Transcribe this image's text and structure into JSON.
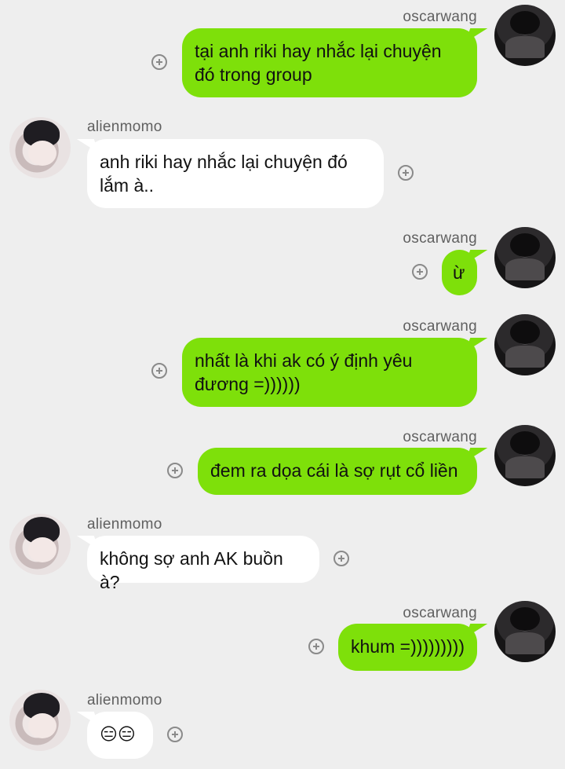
{
  "colors": {
    "background": "#eeeeee",
    "outgoing_bubble": "#7ee00a",
    "incoming_bubble": "#ffffff"
  },
  "messages": [
    {
      "sender": "oscarwang",
      "text": "tại anh riki hay nhắc lại chuyện\nđó trong group"
    },
    {
      "sender": "alienmomo",
      "text": "anh riki hay nhắc lại chuyện đó\nlắm à.."
    },
    {
      "sender": "oscarwang",
      "text": "ừ"
    },
    {
      "sender": "oscarwang",
      "text": "nhất là khi ak có ý định yêu\nđương =))))))"
    },
    {
      "sender": "oscarwang",
      "text": "đem ra dọa cái là sợ rụt cổ liền"
    },
    {
      "sender": "alienmomo",
      "text": "không sợ anh AK buồn à?"
    },
    {
      "sender": "oscarwang",
      "text": "khum =)))))))))"
    },
    {
      "sender": "alienmomo",
      "text": "😑😑"
    }
  ],
  "icons": {
    "add": "plus-circle-icon",
    "avatar_outgoing": "avatar-oscarwang",
    "avatar_incoming": "avatar-alienmomo"
  }
}
